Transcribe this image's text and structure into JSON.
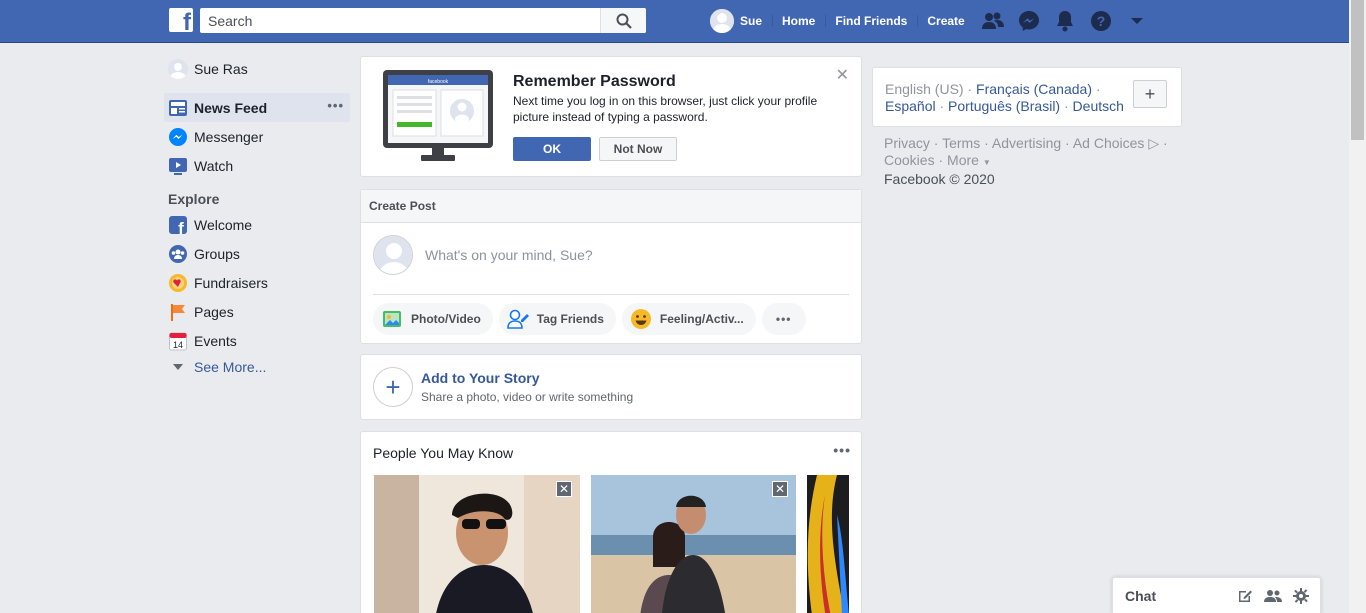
{
  "topbar": {
    "search_placeholder": "Search",
    "user_name": "Sue",
    "home": "Home",
    "find_friends": "Find Friends",
    "create": "Create",
    "brand_color": "#4267b2"
  },
  "leftnav": {
    "profile": "Sue Ras",
    "items": [
      {
        "label": "News Feed",
        "icon": "news-feed-icon"
      },
      {
        "label": "Messenger",
        "icon": "messenger-icon"
      },
      {
        "label": "Watch",
        "icon": "watch-icon"
      }
    ],
    "explore_heading": "Explore",
    "explore": [
      {
        "label": "Welcome",
        "icon": "facebook-icon"
      },
      {
        "label": "Groups",
        "icon": "groups-icon"
      },
      {
        "label": "Fundraisers",
        "icon": "fundraisers-icon"
      },
      {
        "label": "Pages",
        "icon": "flag-icon"
      },
      {
        "label": "Events",
        "icon": "calendar-icon"
      }
    ],
    "see_more": "See More...",
    "events_day": "14"
  },
  "remember": {
    "title": "Remember Password",
    "text": "Next time you log in on this browser, just click your profile picture instead of typing a password.",
    "ok": "OK",
    "not_now": "Not Now",
    "screen_brand": "facebook"
  },
  "create_post": {
    "heading": "Create Post",
    "prompt": "What's on your mind, Sue?",
    "photo_video": "Photo/Video",
    "tag_friends": "Tag Friends",
    "feeling": "Feeling/Activ...",
    "more": "•••"
  },
  "story": {
    "title": "Add to Your Story",
    "subtitle": "Share a photo, video or write something"
  },
  "pymk": {
    "title": "People You May Know",
    "more": "•••"
  },
  "right": {
    "lang_current": "English (US)",
    "lang_links": [
      "Français (Canada)",
      "Español",
      "Português (Brasil)",
      "Deutsch"
    ],
    "footer_links": [
      "Privacy",
      "Terms",
      "Advertising",
      "Ad Choices",
      "Cookies",
      "More"
    ],
    "copyright": "Facebook © 2020"
  },
  "chat": {
    "title": "Chat"
  }
}
